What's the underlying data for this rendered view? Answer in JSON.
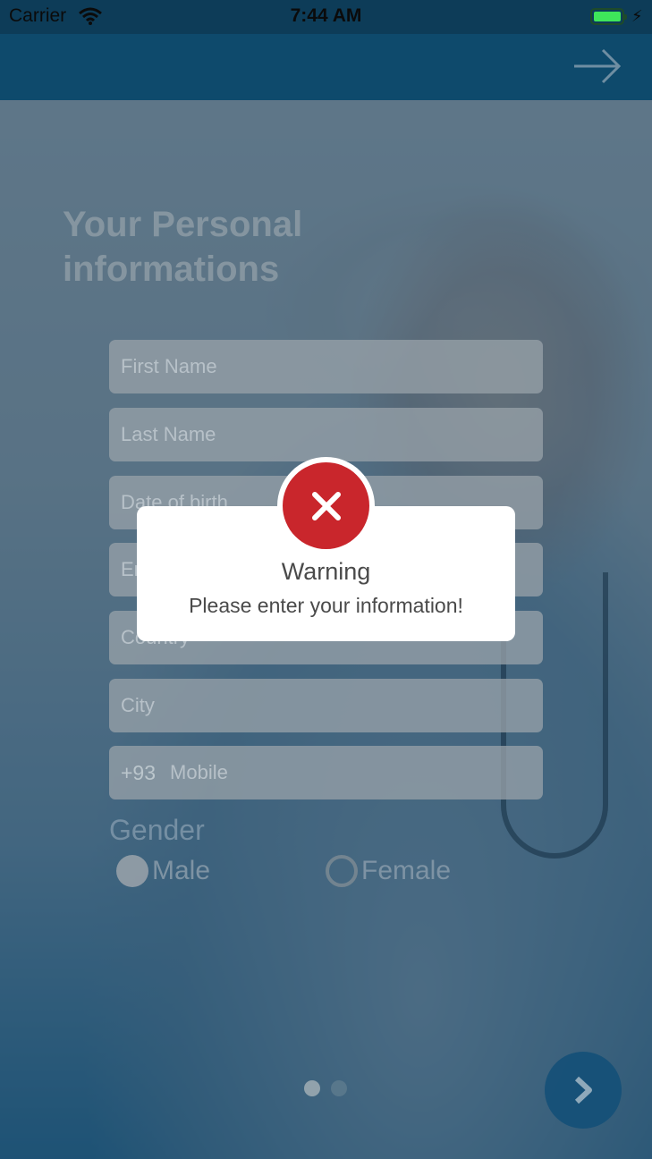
{
  "status_bar": {
    "carrier": "Carrier",
    "time": "7:44 AM"
  },
  "nav": {
    "next_icon": "arrow-right-icon"
  },
  "page": {
    "title": "Your Personal informations"
  },
  "form": {
    "first_name_placeholder": "First Name",
    "last_name_placeholder": "Last Name",
    "dob_placeholder": "Date of birth",
    "email_placeholder": "Email",
    "country_placeholder": "Country",
    "city_placeholder": "City",
    "phone_prefix": "+93",
    "mobile_placeholder": "Mobile",
    "gender_label": "Gender",
    "gender_options": [
      "Male",
      "Female"
    ],
    "gender_selected": "Male"
  },
  "pager": {
    "pages": 2,
    "current": 1,
    "next_icon": "chevron-right-icon"
  },
  "alert": {
    "icon": "close-icon",
    "title": "Warning",
    "message": "Please enter your information!",
    "color": "#c9262c"
  }
}
